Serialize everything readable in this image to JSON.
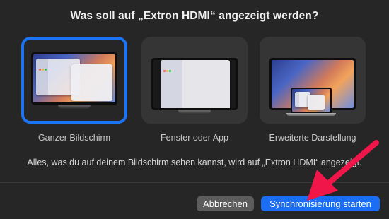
{
  "dialog": {
    "title": "Was soll auf „Extron HDMI“ angezeigt werden?",
    "options": [
      {
        "label": "Ganzer Bildschirm",
        "selected": true
      },
      {
        "label": "Fenster oder App",
        "selected": false
      },
      {
        "label": "Erweiterte Darstellung",
        "selected": false
      }
    ],
    "message": "Alles, was du auf deinem Bildschirm sehen kannst, wird auf „Extron HDMI“ angezeigt.",
    "buttons": {
      "cancel": "Abbrechen",
      "primary": "Synchronisierung starten"
    }
  },
  "colors": {
    "background": "#262626",
    "accent": "#1b6ef3",
    "annotation_arrow": "#f0164a"
  }
}
